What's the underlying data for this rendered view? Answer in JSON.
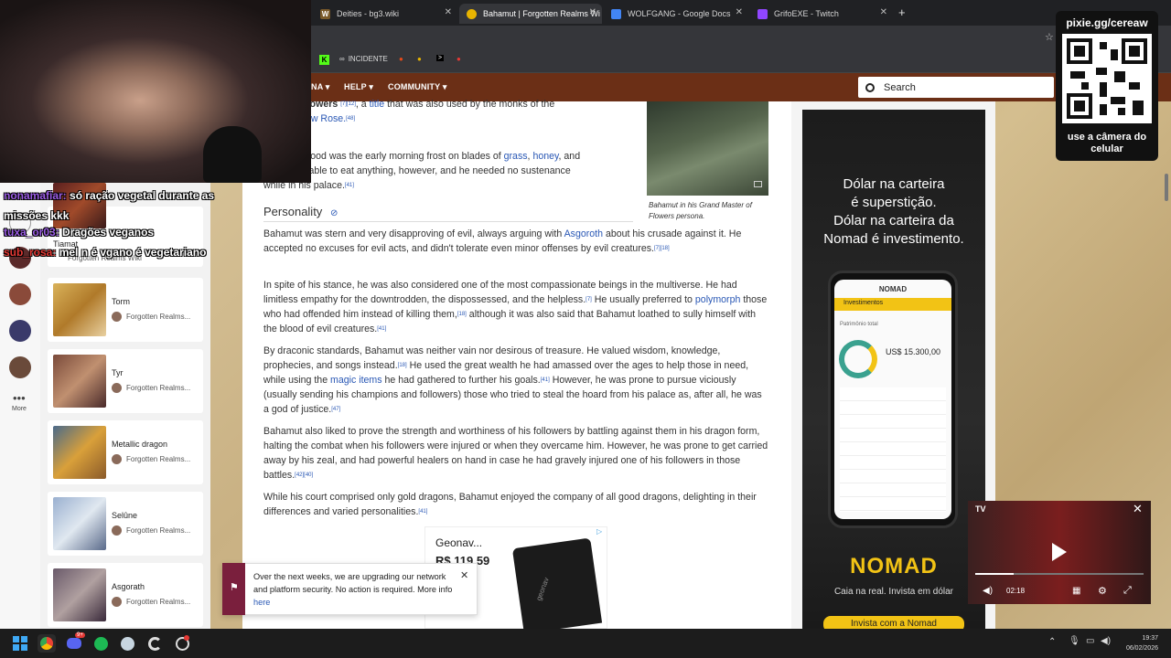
{
  "browser": {
    "tabs": [
      {
        "label": "Deities - bg3.wiki",
        "icon": "W"
      },
      {
        "label": "Bahamut | Forgotten Realms Wi",
        "icon": "dragon-icon"
      },
      {
        "label": "WOLFGANG - Google Docs",
        "icon": "docs-icon"
      },
      {
        "label": "GrifoEXE - Twitch",
        "icon": "twitch-icon"
      }
    ],
    "new_tab": "+",
    "close": "✕",
    "bookmarks": [
      {
        "label": "INCIDENTE"
      }
    ]
  },
  "site_nav": {
    "items": [
      "NA ▾",
      "HELP ▾",
      "COMMUNITY ▾"
    ],
    "search_placeholder": "Search"
  },
  "article": {
    "top_fragment_1": "aster of Flowers",
    "top_fragment_1b": ", a",
    "top_link_title": "title",
    "top_fragment_1c": " that was also used by the monks of the",
    "top_fragment_2": "of the Yellow Rose.",
    "food_fragment": "favored food was the early morning frost on blades of",
    "food_link_grass": "grass",
    "food_link_honey": "honey",
    "food_and": "and",
    "food_line2": "s. He was able to eat anything, however, and he needed no sustenance",
    "food_line3": "while in his palace.",
    "figure_caption": "Bahamut in his Grand Master of Flowers persona.",
    "heading": "Personality",
    "p1_a": "Bahamut was stern and very disapproving of evil, always arguing with",
    "p1_link": "Asgoroth",
    "p1_b": "about his crusade against it. He accepted no excuses for evil acts, and didn't tolerate even minor offenses by evil creatures.",
    "p2_a": "In spite of his stance, he was also considered one of the most compassionate beings in the multiverse. He had limitless empathy for the downtrodden, the dispossessed, and the helpless.",
    "p2_b": "He usually preferred to",
    "p2_link": "polymorph",
    "p2_c": "those who had offended him instead of killing them,",
    "p2_d": "although it was also said that Bahamut loathed to sully himself with the blood of evil creatures.",
    "p3_a": "By draconic standards, Bahamut was neither vain nor desirous of treasure. He valued wisdom, knowledge, prophecies, and songs instead.",
    "p3_b": "He used the great wealth he had amassed over the ages to help those in need, while using the",
    "p3_link": "magic items",
    "p3_c": "he had gathered to further his goals.",
    "p3_d": "However, he was prone to pursue viciously (usually sending his champions and followers) those who tried to steal the hoard from his palace as, after all, he was a god of justice.",
    "p4": "Bahamut also liked to prove the strength and worthiness of his followers by battling against them in his dragon form, halting the combat when his followers were injured or when they overcame him. However, he was prone to get carried away by his zeal, and had powerful healers on hand in case he had gravely injured one of his followers in those battles.",
    "p5": "While his court comprised only gold dragons, Bahamut enjoyed the company of all good dragons, delighting in their differences and varied personalities.",
    "refs": {
      "r1": "[7][12]",
      "r2": "[48]",
      "r3": "[41]",
      "r4": "[7][18]",
      "r5": "[7]",
      "r6": "[18]",
      "r7": "[41]",
      "r8": "[18]",
      "r9": "[41]",
      "r10": "[47]",
      "r11": "[42][40]",
      "r12": "[41]"
    }
  },
  "sidebar": {
    "more_label": "More",
    "partial_title": "Tiamat",
    "partial_src": "Forgotten Realms Wiki",
    "cards": [
      {
        "title": "Torm",
        "src": "Forgotten Realms..."
      },
      {
        "title": "Tyr",
        "src": "Forgotten Realms..."
      },
      {
        "title": "Metallic dragon",
        "src": "Forgotten Realms..."
      },
      {
        "title": "Selûne",
        "src": "Forgotten Realms..."
      },
      {
        "title": "Asgorath",
        "src": "Forgotten Realms..."
      }
    ]
  },
  "chat": [
    {
      "user": "nonamafiar:",
      "msg": "só ração vegetal durante as missões kkk"
    },
    {
      "user": "tuxa_or03:",
      "msg": "Dragões veganos"
    },
    {
      "user": "sub_rosa:",
      "msg": "mel n é vgano é vegetariano"
    }
  ],
  "recent_label": "RECENT",
  "ad": {
    "line1": "Dólar na carteira",
    "line2": "é superstição.",
    "line3": "Dólar na carteira da",
    "line4": "Nomad é investimento.",
    "phone_brand": "NOMAD",
    "phone_section": "Investimentos",
    "phone_total_label": "Patrimônio total",
    "phone_amount": "US$ 15.300,00",
    "logo": "NOMAD",
    "tagline": "Caia na real. Invista em dólar",
    "button": "Invista com a Nomad"
  },
  "qr": {
    "title": "pixie.gg/cereaw",
    "caption": "use a câmera do celular"
  },
  "video": {
    "time": "02:18",
    "badge": "TV",
    "close": "✕"
  },
  "notice": {
    "text": "Over the next weeks, we are upgrading our network and platform security. No action is required. More info",
    "link": "here",
    "close": "✕"
  },
  "product_ad": {
    "title": "Geonav...",
    "price": "R$ 119,59",
    "brand_on_product": "geonav"
  },
  "taskbar": {
    "time": "19:37",
    "date": "06/02/2026",
    "badge": "9+"
  },
  "colors": {
    "accent_nav": "#6b2f16",
    "link": "#2a58b5",
    "nomad_yellow": "#f2c315",
    "chat_user": "#9b5de5"
  }
}
